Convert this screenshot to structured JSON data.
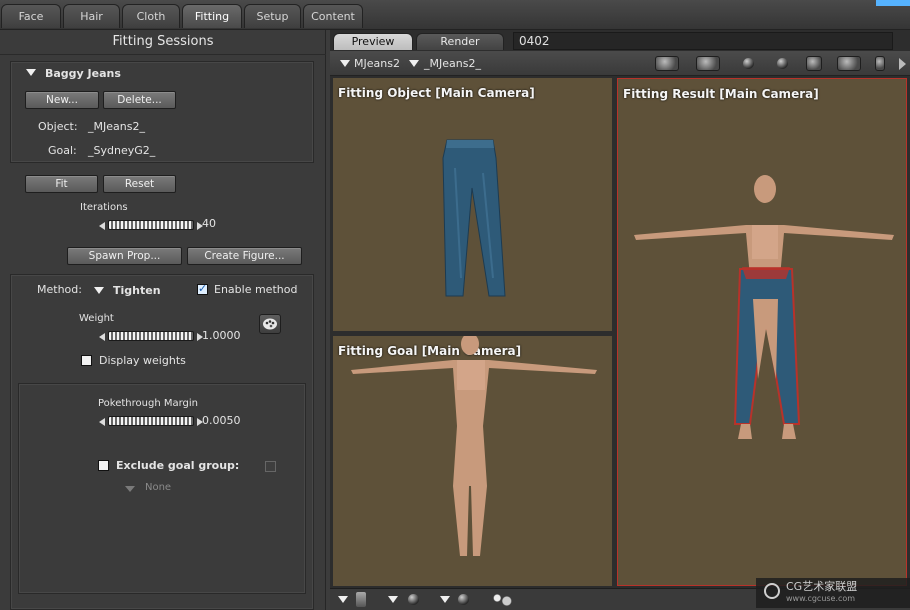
{
  "top_tabs": [
    "Face",
    "Hair",
    "Cloth",
    "Fitting",
    "Setup",
    "Content"
  ],
  "active_tab": "Fitting",
  "left": {
    "title": "Fitting Sessions",
    "session_name": "Baggy Jeans",
    "new_label": "New...",
    "delete_label": "Delete...",
    "object_label": "Object:",
    "object_value": "_MJeans2_",
    "goal_label": "Goal:",
    "goal_value": "_SydneyG2_",
    "fit_label": "Fit",
    "reset_label": "Reset",
    "iterations_label": "Iterations",
    "iterations_value": "40",
    "spawn_prop_label": "Spawn Prop...",
    "create_figure_label": "Create Figure...",
    "method_label": "Method:",
    "method_value": "Tighten",
    "enable_method_label": "Enable method",
    "enable_method_checked": true,
    "weight_label": "Weight",
    "weight_value": "1.0000",
    "display_weights_label": "Display weights",
    "display_weights_checked": false,
    "pokethrough_label": "Pokethrough Margin",
    "pokethrough_value": "0.0050",
    "exclude_goal_label": "Exclude goal group:",
    "exclude_goal_checked": false,
    "exclude_goal_group_value": "None"
  },
  "right": {
    "preview_tab": "Preview",
    "render_tab": "Render",
    "frame_value": "0402",
    "object_selector": "MJeans2",
    "figure_selector": "_MJeans2_",
    "viewport_object_title": "Fitting Object [Main Camera]",
    "viewport_goal_title": "Fitting Goal [Main Camera]",
    "viewport_result_title": "Fitting Result [Main Camera]"
  },
  "watermark": {
    "line1": "CG艺术家联盟",
    "line2": "www.cgcuse.com"
  },
  "colors": {
    "viewport_bg": "#5e5139",
    "jeans": "#2e5a78",
    "skin": "#c89a7c",
    "result_border": "#b8322a"
  }
}
